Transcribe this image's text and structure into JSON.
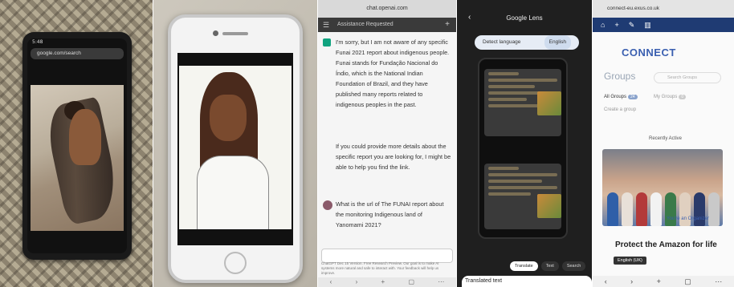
{
  "panel1": {
    "status_time": "5:48",
    "url": "google.com/search"
  },
  "panel2": {},
  "panel3": {
    "url": "chat.openai.com",
    "header": "Assistance Requested",
    "reply_1": "I'm sorry, but I am not aware of any specific Funai 2021 report about indigenous people. Funai stands for Fundação Nacional do Índio, which is the National Indian Foundation of Brazil, and they have published many reports related to indigenous peoples in the past.",
    "reply_2": "If you could provide more details about the specific report you are looking for, I might be able to help you find the link.",
    "user_q": "What is the url of The FUNAI report about the monitoring Indigenous land of Yanomami 2021?",
    "footer": "ChatGPT Dec 15 Version. Free Research Preview. Our goal is to make AI systems more natural and safe to interact with. Your feedback will help us improve."
  },
  "panel4": {
    "title": "Google Lens",
    "source_lang": "Detect language",
    "target_lang": "English",
    "chip_translate": "Translate",
    "chip_text": "Text",
    "chip_search": "Search",
    "translated": "Translated text"
  },
  "panel5": {
    "url": "connect-eu.exus.co.uk",
    "brand": "CONNECT",
    "page_title": "Groups",
    "search_placeholder": "Search Groups",
    "tab_all": "All Groups",
    "tab_all_count": "24",
    "tab_mine": "My Groups",
    "tab_mine_count": "0",
    "create": "Create a group",
    "sort": "Recently Active",
    "org_button": "You're an Organizer",
    "group_name": "Protect the Amazon for life",
    "lang_tag": "English (UK)"
  }
}
